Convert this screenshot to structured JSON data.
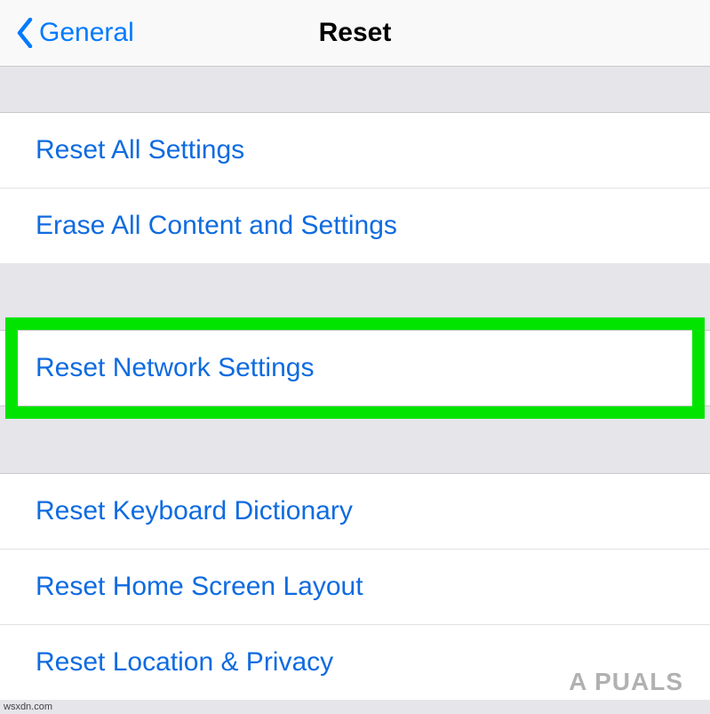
{
  "nav": {
    "back_label": "General",
    "title": "Reset"
  },
  "group1": {
    "items": [
      "Reset All Settings",
      "Erase All Content and Settings"
    ]
  },
  "group2": {
    "items": [
      "Reset Network Settings"
    ]
  },
  "group3": {
    "items": [
      "Reset Keyboard Dictionary",
      "Reset Home Screen Layout",
      "Reset Location & Privacy"
    ]
  },
  "watermark": "A PUALS",
  "source": "wsxdn.com"
}
